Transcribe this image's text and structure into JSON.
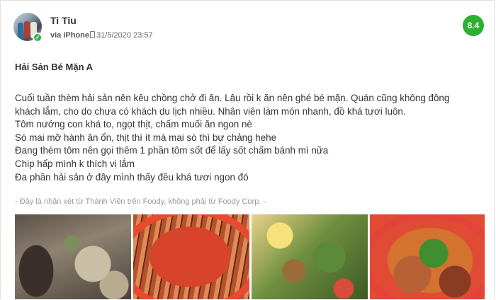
{
  "review": {
    "user": {
      "name": "Ti Tiu",
      "verified_icon": "check-badge-icon"
    },
    "meta": {
      "via": "via iPhone",
      "device_icon": "phone-icon",
      "timestamp": "31/5/2020 23:57"
    },
    "score": "8.4",
    "score_color": "#2bb032",
    "title": "Hải Sản Bé Mặn A",
    "lines": [
      "Cuối tuần thèm hải sản nên kêu chồng chở đi ăn. Lâu rồi k ăn nên ghé bé mặn. Quán cũng không đông",
      "khách lắm, cho do chưa có khách du lịch nhiều. Nhân viên làm món nhanh, đồ khá tươi luôn.",
      "Tôm nướng con khá to, ngọt thịt, chấm muối ăn ngon nè",
      "Sò mai mỡ hành ăn ổn, thịt thì ít mà mai sò thì bự chảng hehe",
      "Đang thèm tôm nên gọi thêm 1 phần tôm sốt để lấy sốt chấm bánh mì nữa",
      "Chip hấp mình k thích vị lắm",
      "Đa phần hải sản ở đây mình thấy đều khá tươi ngon đó"
    ],
    "disclaimer": "- Đây là nhận xét từ Thành Viên trên Foody, không phải từ Foody Corp. -",
    "photos": [
      {
        "subject": "mai-mo-hanh-photo"
      },
      {
        "subject": "tom-nuong-photo"
      },
      {
        "subject": "salad-photo"
      },
      {
        "subject": "tom-sot-photo"
      }
    ]
  }
}
